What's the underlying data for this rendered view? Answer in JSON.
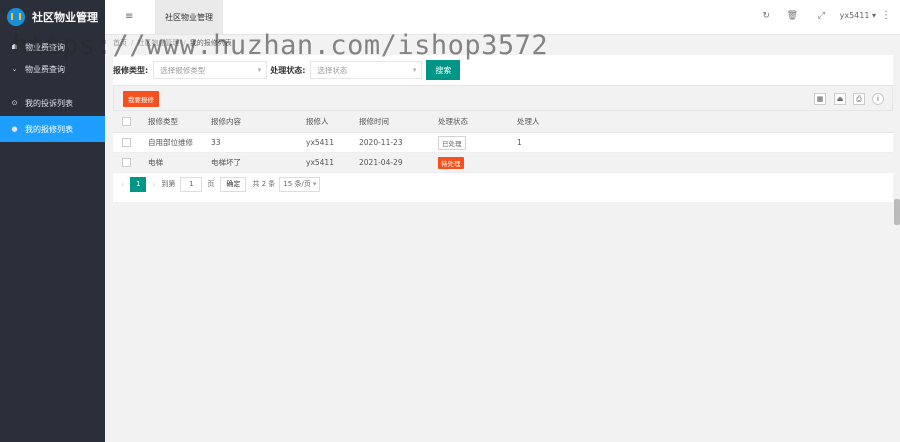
{
  "app": {
    "title": "社区物业管理"
  },
  "sidebar": {
    "items": [
      {
        "label": "物业费查询",
        "icon": "dashboard-icon",
        "active": false
      },
      {
        "label": "物业费查询",
        "icon": "chevron-icon",
        "active": false
      },
      {
        "label": "我的投诉列表",
        "icon": "circle-icon",
        "active": false
      },
      {
        "label": "我的报修列表",
        "icon": "dot-icon",
        "active": true
      }
    ]
  },
  "header": {
    "menu_icon": "≡",
    "tab_label": "社区物业管理",
    "user": "yx5411 ▾",
    "more": "⋮"
  },
  "breadcrumb": {
    "home": "首页",
    "section": "社区物业管理",
    "current": "我的报修列表"
  },
  "filters": {
    "type_label": "报修类型:",
    "type_placeholder": "选择报修类型",
    "status_label": "处理状态:",
    "status_placeholder": "选择状态",
    "search_button": "搜索"
  },
  "toolbar": {
    "add_button": "我要报修"
  },
  "table": {
    "headers": [
      "报修类型",
      "报修内容",
      "报修人",
      "报修时间",
      "处理状态",
      "处理人"
    ],
    "rows": [
      {
        "type": "自用部位维修",
        "content": "33",
        "person": "yx5411",
        "time": "2020-11-23",
        "status": "已处理",
        "handler": "1"
      },
      {
        "type": "电梯",
        "content": "电梯坏了",
        "person": "yx5411",
        "time": "2021-04-29",
        "status": "待处理",
        "handler": ""
      }
    ]
  },
  "pager": {
    "current": "1",
    "goto": "到第",
    "page_value": "1",
    "page_unit": "页",
    "confirm": "确定",
    "total": "共 2 条",
    "per_page": "15 条/页"
  },
  "watermark": "https://www.huzhan.com/ishop3572",
  "colors": {
    "sidebar": "#2b2f3a",
    "active": "#1e9fff",
    "primary": "#009688",
    "accent": "#f4511e"
  }
}
